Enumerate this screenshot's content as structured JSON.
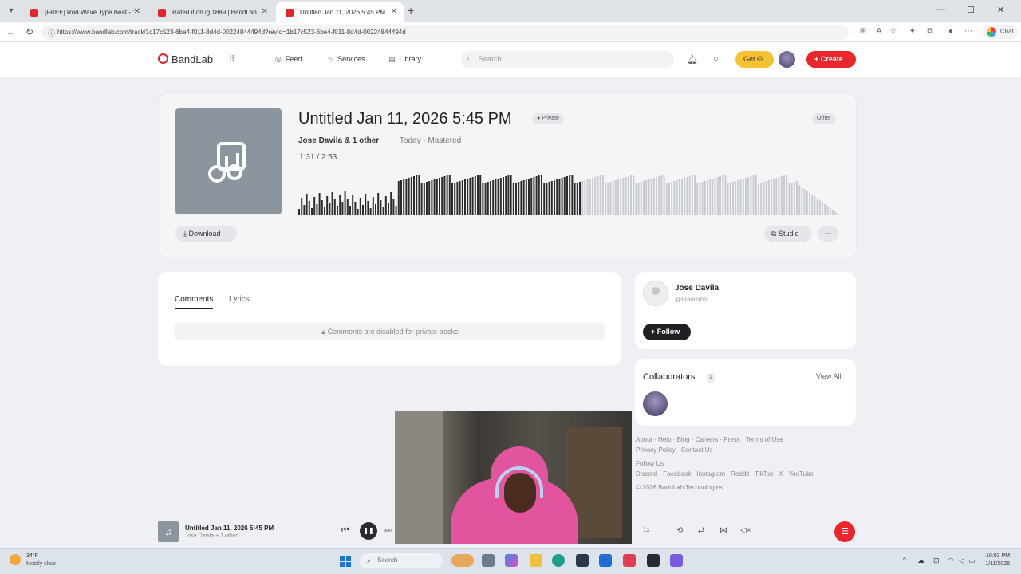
{
  "browser": {
    "tabs": [
      {
        "label": "[FREE] Rod Wave Type Beat - \"..."
      },
      {
        "label": "Rated it on ig 1889 | BandLab"
      },
      {
        "label": "Untitled Jan 11, 2026 5:45 PM"
      }
    ],
    "url": "https://www.bandlab.com/track/1c17c523-6be4-f011-8d4d-00224844494d?revId=1b17c523-6be4-f011-8d4d-00224844494d",
    "profile_label": "Chat"
  },
  "header": {
    "logo": "BandLab",
    "nav": [
      {
        "label": "Feed",
        "icon": "compass-icon"
      },
      {
        "label": "Services",
        "icon": "star-icon"
      },
      {
        "label": "Library",
        "icon": "library-icon"
      }
    ],
    "search_placeholder": "Search",
    "get_label": "Get",
    "create_label": "+ Create"
  },
  "track": {
    "title": "Untitled Jan 11, 2026 5:45 PM",
    "privacy": "Private",
    "genre": "Other",
    "artists": "Jose Davila & 1 other",
    "meta": "· Today · Mastered",
    "time": "1:31 / 2:53",
    "progress_fraction": 0.526,
    "download_label": "Download",
    "studio_label": "Studio",
    "more_label": "···"
  },
  "comments": {
    "tab_comments": "Comments",
    "tab_lyrics": "Lyrics",
    "disabled_note": "Comments are disabled for private tracks"
  },
  "artist": {
    "name": "Jose Davila",
    "handle": "@8rawsmo",
    "follow_label": "Follow"
  },
  "collaborators": {
    "title": "Collaborators",
    "count": "1",
    "view_all": "View All"
  },
  "footer": {
    "links_row1": [
      "About",
      "Help",
      "Blog",
      "Careers",
      "Press",
      "Terms of Use"
    ],
    "links_row2": [
      "Privacy Policy",
      "Contact Us"
    ],
    "follow_us": "Follow Us",
    "social": [
      "Discord",
      "Facebook",
      "Instagram",
      "Reddit",
      "TikTok",
      "X",
      "YouTube"
    ],
    "copyright": "© 2026 BandLab Technologies"
  },
  "player": {
    "title": "Untitled Jan 11, 2026 5:45 PM",
    "sub": "Jose Davila + 1 other",
    "speed": "1x"
  },
  "taskbar": {
    "temp": "34°F",
    "weather": "Mostly clear",
    "search_placeholder": "Search",
    "time": "10:03 PM",
    "date": "1/11/2026"
  },
  "colors": {
    "brand_red": "#e8262c",
    "get_yellow": "#f5c232",
    "played_wave": "#2b2b2b",
    "unplayed_wave": "#c8cbcf"
  }
}
